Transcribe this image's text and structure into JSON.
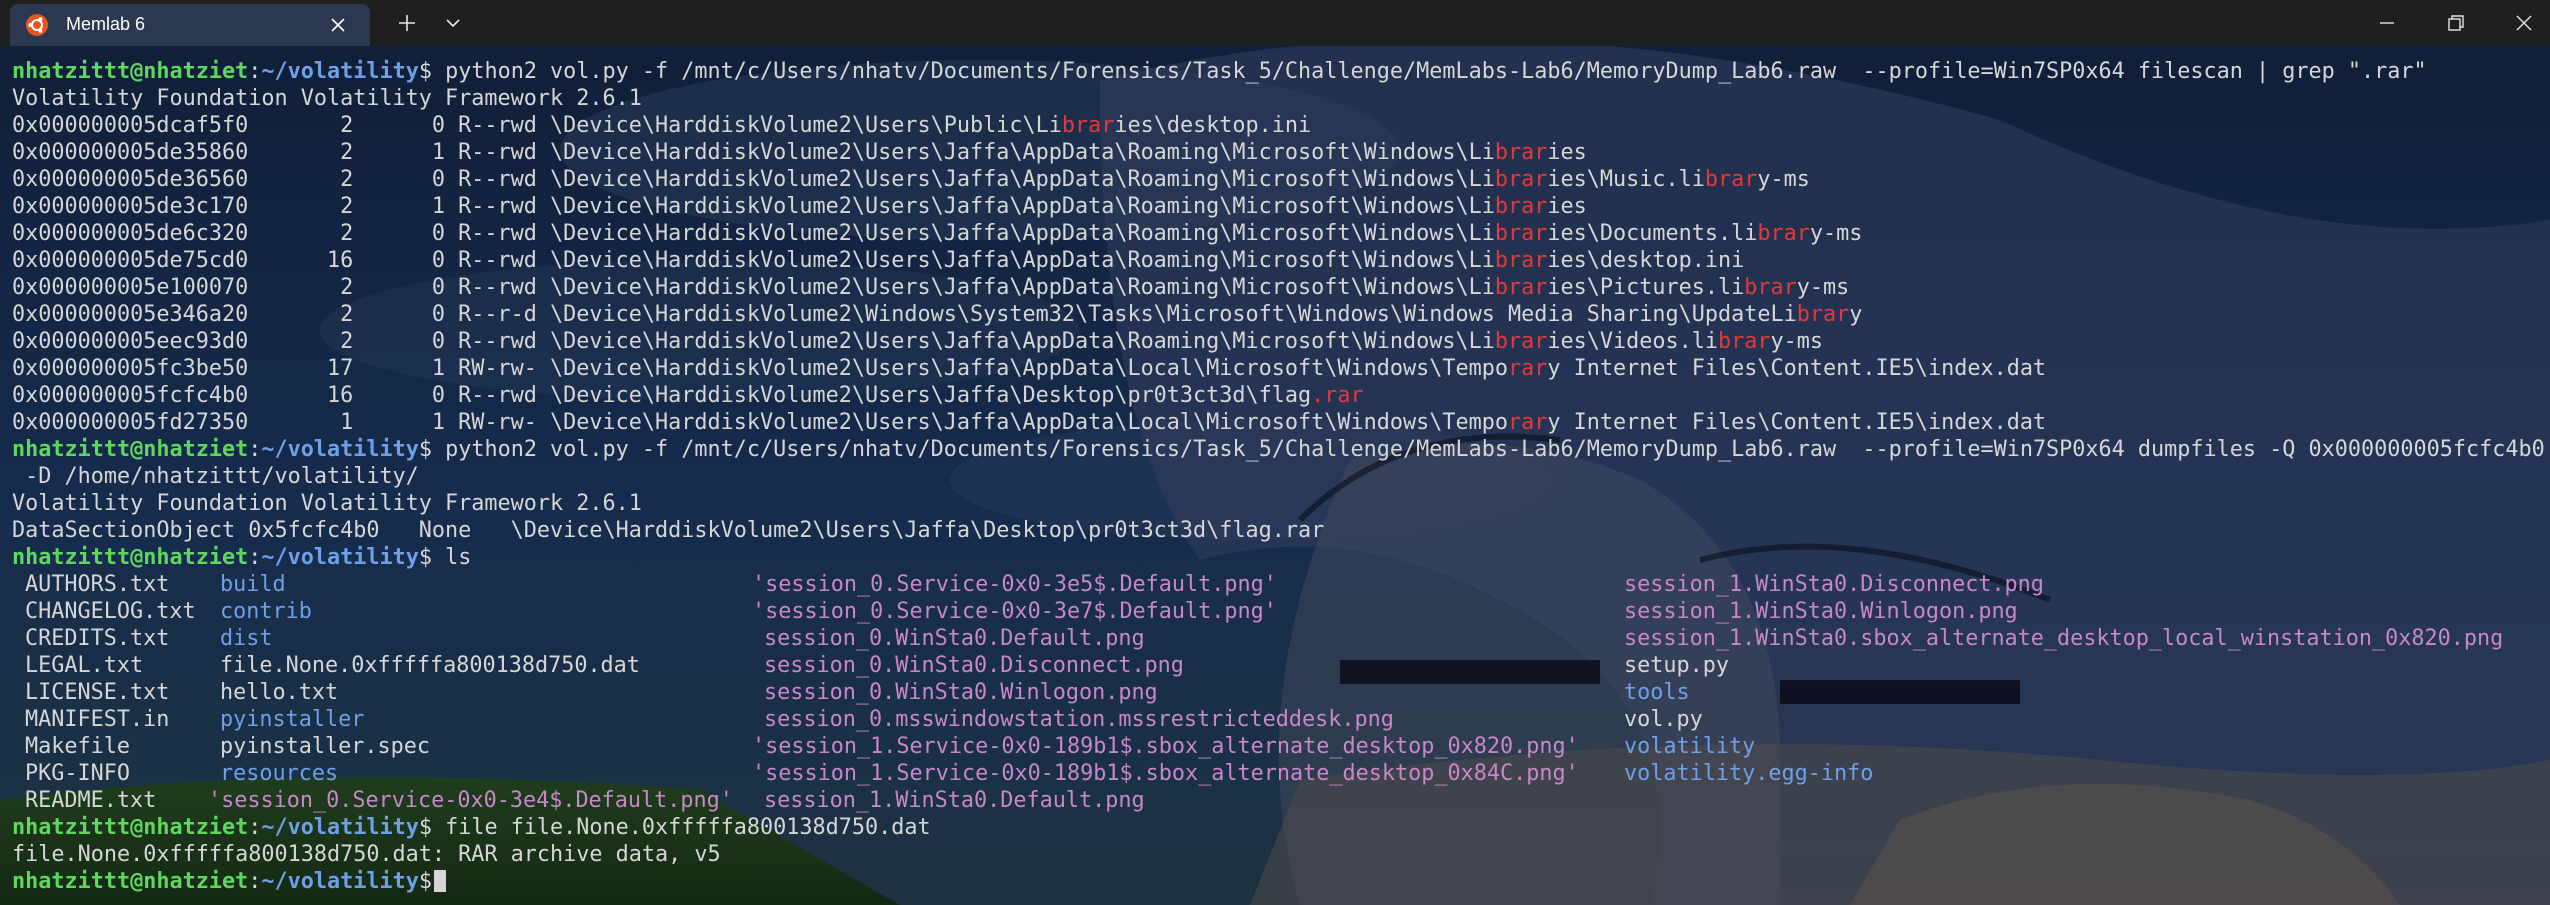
{
  "window": {
    "tab_title": "Memlab 6",
    "icons": [
      "ubuntu-icon",
      "close-icon",
      "plus-icon",
      "chevron-down-icon",
      "minimize-icon",
      "restore-icon",
      "close-icon"
    ]
  },
  "colors": {
    "prompt_user": "#5fd75f",
    "prompt_path": "#6f9fe6",
    "highlight": "#e23a3a",
    "directory": "#6f9fe6",
    "image_file": "#c887c8",
    "text": "#d6d6d6"
  },
  "prompt": {
    "user": "nhatzittt@nhatziet",
    "colon": ":",
    "path": "~/volatility",
    "symbol": "$"
  },
  "terminal": {
    "cmd1": " python2 vol.py -f /mnt/c/Users/nhatv/Documents/Forensics/Task_5/Challenge/MemLabs-Lab6/MemoryDump_Lab6.raw  --profile=Win7SP0x64 filescan | grep \".rar\"",
    "banner1": "Volatility Foundation Volatility Framework 2.6.1",
    "scan": [
      {
        "pre": "0x000000005dcaf5f0       2      0 R--rwd \\Device\\HarddiskVolume2\\Users\\Public\\Li",
        "hl": "brar",
        "post": "ies\\desktop.ini"
      },
      {
        "pre": "0x000000005de35860       2      1 R--rwd \\Device\\HarddiskVolume2\\Users\\Jaffa\\AppData\\Roaming\\Microsoft\\Windows\\Li",
        "hl": "brar",
        "post": "ies"
      },
      {
        "pre": "0x000000005de36560       2      0 R--rwd \\Device\\HarddiskVolume2\\Users\\Jaffa\\AppData\\Roaming\\Microsoft\\Windows\\Li",
        "hl": "brar",
        "post": "ies\\Music.li",
        "hl2": "brar",
        "post2": "y-ms"
      },
      {
        "pre": "0x000000005de3c170       2      1 R--rwd \\Device\\HarddiskVolume2\\Users\\Jaffa\\AppData\\Roaming\\Microsoft\\Windows\\Li",
        "hl": "brar",
        "post": "ies"
      },
      {
        "pre": "0x000000005de6c320       2      0 R--rwd \\Device\\HarddiskVolume2\\Users\\Jaffa\\AppData\\Roaming\\Microsoft\\Windows\\Li",
        "hl": "brar",
        "post": "ies\\Documents.li",
        "hl2": "brar",
        "post2": "y-ms"
      },
      {
        "pre": "0x000000005de75cd0      16      0 R--rwd \\Device\\HarddiskVolume2\\Users\\Jaffa\\AppData\\Roaming\\Microsoft\\Windows\\Li",
        "hl": "brar",
        "post": "ies\\desktop.ini"
      },
      {
        "pre": "0x000000005e100070       2      0 R--rwd \\Device\\HarddiskVolume2\\Users\\Jaffa\\AppData\\Roaming\\Microsoft\\Windows\\Li",
        "hl": "brar",
        "post": "ies\\Pictures.li",
        "hl2": "brar",
        "post2": "y-ms"
      },
      {
        "pre": "0x000000005e346a20       2      0 R--r-d \\Device\\HarddiskVolume2\\Windows\\System32\\Tasks\\Microsoft\\Windows\\Windows Media Sharing\\UpdateLi",
        "hl": "brar",
        "post": "y"
      },
      {
        "pre": "0x000000005eec93d0       2      0 R--rwd \\Device\\HarddiskVolume2\\Users\\Jaffa\\AppData\\Roaming\\Microsoft\\Windows\\Li",
        "hl": "brar",
        "post": "ies\\Videos.li",
        "hl2": "brar",
        "post2": "y-ms"
      },
      {
        "pre": "0x000000005fc3be50      17      1 RW-rw- \\Device\\HarddiskVolume2\\Users\\Jaffa\\AppData\\Local\\Microsoft\\Windows\\Tempo",
        "hl": "rar",
        "post": "y Internet Files\\Content.IE5\\index.dat"
      },
      {
        "pre": "0x000000005fcfc4b0      16      0 R--rwd \\Device\\HarddiskVolume2\\Users\\Jaffa\\Desktop\\pr0t3ct3d\\flag",
        "hl": ".rar",
        "post": ""
      },
      {
        "pre": "0x000000005fd27350       1      1 RW-rw- \\Device\\HarddiskVolume2\\Users\\Jaffa\\AppData\\Local\\Microsoft\\Windows\\Tempo",
        "hl": "rar",
        "post": "y Internet Files\\Content.IE5\\index.dat"
      }
    ],
    "cmd2": " python2 vol.py -f /mnt/c/Users/nhatv/Documents/Forensics/Task_5/Challenge/MemLabs-Lab6/MemoryDump_Lab6.raw  --profile=Win7SP0x64 dumpfiles -Q 0x000000005fcfc4b0",
    "cmd2_cont": " -D /home/nhatzittt/volatility/",
    "banner2": "Volatility Foundation Volatility Framework 2.6.1",
    "dump_line": "DataSectionObject 0x5fcfc4b0   None   \\Device\\HarddiskVolume2\\Users\\Jaffa\\Desktop\\pr0t3ct3d\\flag.rar",
    "cmd3": " ls",
    "ls_rows": [
      [
        {
          "t": "AUTHORS.txt",
          "k": "f-plain"
        },
        {
          "t": "build",
          "k": "f-dir"
        },
        {
          "t": "'session_0.Service-0x0-3e5$.Default.png'",
          "k": "f-img",
          "o": -12
        },
        {
          "t": "session_1.WinSta0.Disconnect.png",
          "k": "f-img"
        }
      ],
      [
        {
          "t": "CHANGELOG.txt",
          "k": "f-plain"
        },
        {
          "t": "contrib",
          "k": "f-dir"
        },
        {
          "t": "'session_0.Service-0x0-3e7$.Default.png'",
          "k": "f-img",
          "o": -12
        },
        {
          "t": "session_1.WinSta0.Winlogon.png",
          "k": "f-img"
        }
      ],
      [
        {
          "t": "CREDITS.txt",
          "k": "f-plain"
        },
        {
          "t": "dist",
          "k": "f-dir"
        },
        {
          "t": "session_0.WinSta0.Default.png",
          "k": "f-img"
        },
        {
          "t": "session_1.WinSta0.sbox_alternate_desktop_local_winstation_0x820.png",
          "k": "f-img"
        }
      ],
      [
        {
          "t": "LEGAL.txt",
          "k": "f-plain"
        },
        {
          "t": "file.None.0xfffffa800138d750.dat",
          "k": "f-plain"
        },
        {
          "t": "session_0.WinSta0.Disconnect.png",
          "k": "f-img"
        },
        {
          "t": "setup.py",
          "k": "f-plain"
        }
      ],
      [
        {
          "t": "LICENSE.txt",
          "k": "f-plain"
        },
        {
          "t": "hello.txt",
          "k": "f-plain"
        },
        {
          "t": "session_0.WinSta0.Winlogon.png",
          "k": "f-img"
        },
        {
          "t": "tools",
          "k": "f-dir"
        }
      ],
      [
        {
          "t": "MANIFEST.in",
          "k": "f-plain"
        },
        {
          "t": "pyinstaller",
          "k": "f-dir"
        },
        {
          "t": "session_0.msswindowstation.mssrestricteddesk.png",
          "k": "f-img"
        },
        {
          "t": "vol.py",
          "k": "f-plain"
        }
      ],
      [
        {
          "t": "Makefile",
          "k": "f-plain"
        },
        {
          "t": "pyinstaller.spec",
          "k": "f-plain"
        },
        {
          "t": "'session_1.Service-0x0-189b1$.sbox_alternate_desktop_0x820.png'",
          "k": "f-img",
          "o": -12
        },
        {
          "t": "volatility",
          "k": "f-dir"
        }
      ],
      [
        {
          "t": "PKG-INFO",
          "k": "f-plain"
        },
        {
          "t": "resources",
          "k": "f-dir"
        },
        {
          "t": "'session_1.Service-0x0-189b1$.sbox_alternate_desktop_0x84C.png'",
          "k": "f-img",
          "o": -12
        },
        {
          "t": "volatility.egg-info",
          "k": "f-dir"
        }
      ],
      [
        {
          "t": "README.txt",
          "k": "f-plain"
        },
        {
          "t": "'session_0.Service-0x0-3e4$.Default.png'",
          "k": "f-img",
          "o": -12
        },
        {
          "t": "session_1.WinSta0.Default.png",
          "k": "f-img"
        },
        {
          "t": "",
          "k": "f-plain"
        }
      ]
    ],
    "cmd4": " file file.None.0xfffffa800138d750.dat",
    "file_result": "file.None.0xfffffa800138d750.dat: RAR archive data, v5"
  }
}
